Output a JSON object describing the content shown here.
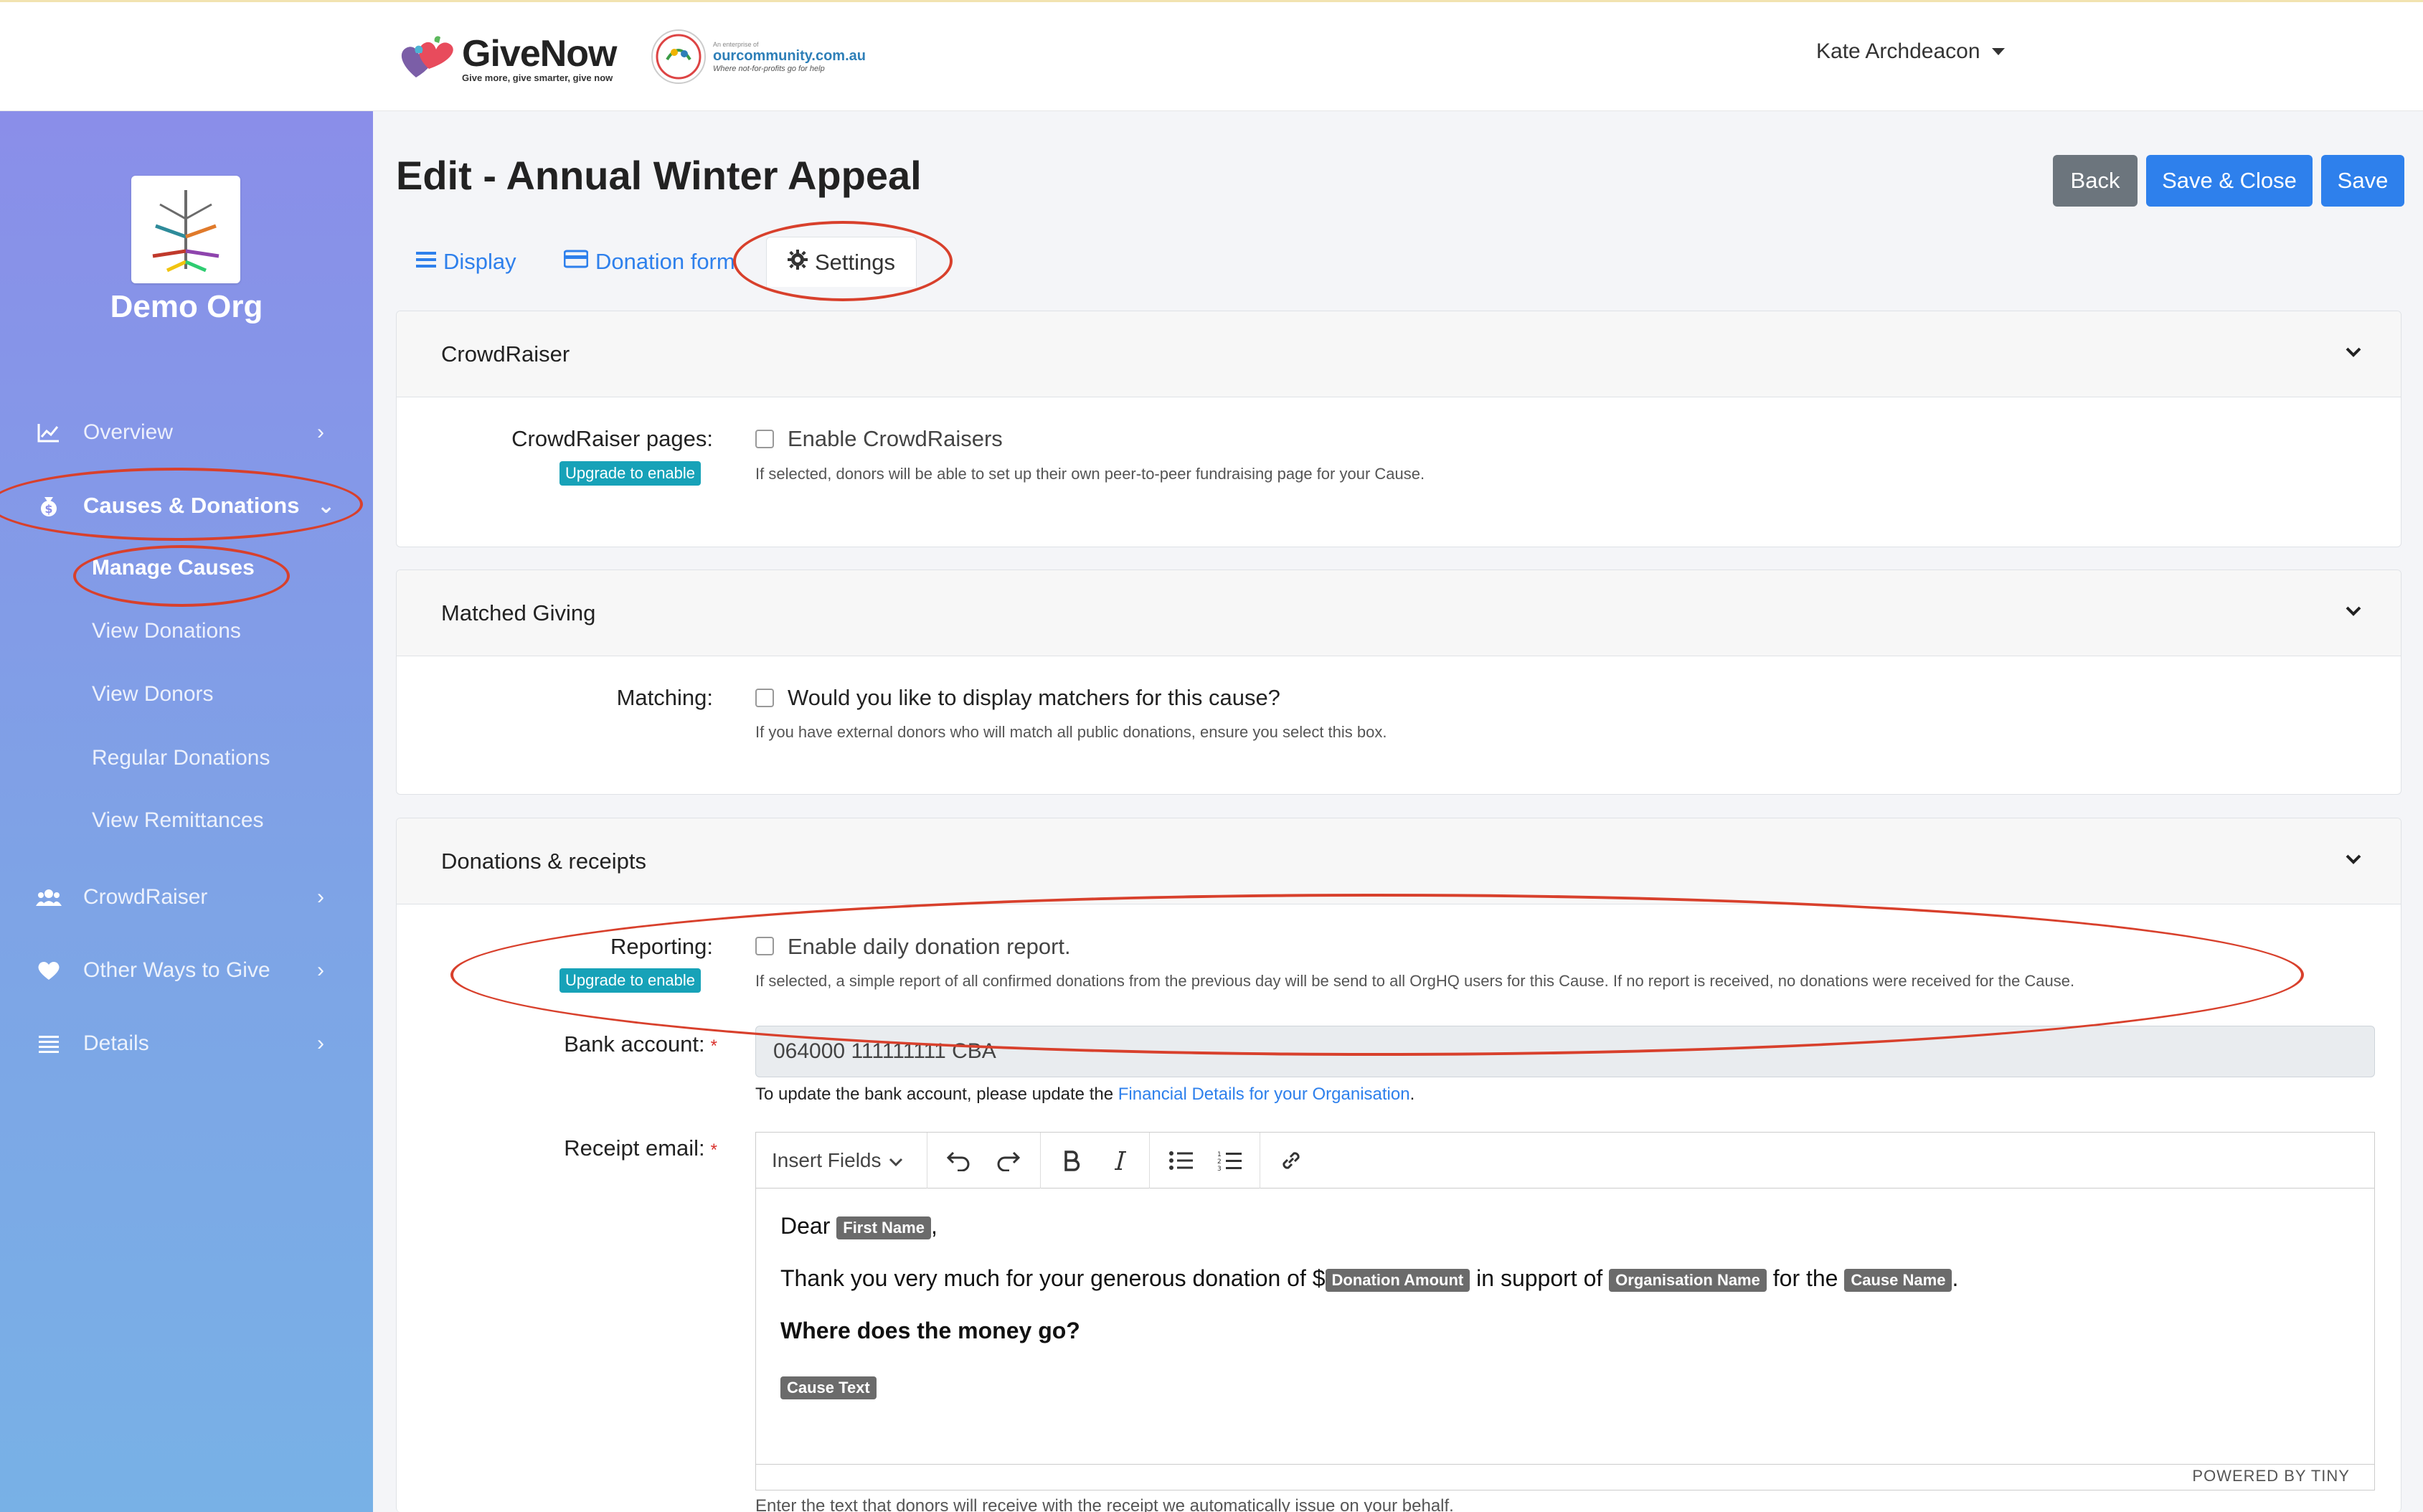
{
  "topbar": {
    "brand_name": "GiveNow",
    "brand_tagline": "Give more, give smarter, give now",
    "partner_small": "An enterprise of",
    "partner_name": "ourcommunity.com.au",
    "partner_tagline": "Where not-for-profits go for help",
    "user_name": "Kate Archdeacon"
  },
  "sidebar": {
    "org_name": "Demo Org",
    "items": [
      {
        "label": "Overview",
        "icon": "chart-line-icon"
      },
      {
        "label": "Causes & Donations",
        "icon": "money-bag-icon"
      },
      {
        "label": "CrowdRaiser",
        "icon": "users-icon"
      },
      {
        "label": "Other Ways to Give",
        "icon": "heart-icon"
      },
      {
        "label": "Details",
        "icon": "list-icon"
      }
    ],
    "subitems": [
      "Manage Causes",
      "View Donations",
      "View Donors",
      "Regular Donations",
      "View Remittances"
    ]
  },
  "page": {
    "title": "Edit - Annual Winter Appeal",
    "buttons": {
      "back": "Back",
      "save_close": "Save & Close",
      "save": "Save"
    },
    "tabs": {
      "display": "Display",
      "donation_form": "Donation form",
      "settings": "Settings"
    }
  },
  "crowdraiser": {
    "title": "CrowdRaiser",
    "label": "CrowdRaiser pages:",
    "badge": "Upgrade to enable",
    "checkbox": "Enable CrowdRaisers",
    "help": "If selected, donors will be able to set up their own peer-to-peer fundraising page for your Cause."
  },
  "matched": {
    "title": "Matched Giving",
    "label": "Matching:",
    "checkbox": "Would you like to display matchers for this cause?",
    "help": "If you have external donors who will match all public donations, ensure you select this box."
  },
  "donations": {
    "title": "Donations & receipts",
    "reporting_label": "Reporting:",
    "badge": "Upgrade to enable",
    "reporting_checkbox": "Enable daily donation report.",
    "reporting_help": "If selected, a simple report of all confirmed donations from the previous day will be send to all OrgHQ users for this Cause. If no report is received, no donations were received for the Cause.",
    "bank_label": "Bank account:",
    "bank_value": "064000 111111111 CBA",
    "bank_help_prefix": "To update the bank account, please update the ",
    "bank_help_link": "Financial Details for your Organisation",
    "bank_help_suffix": ".",
    "receipt_label": "Receipt email:",
    "required_mark": "*",
    "editor": {
      "insert_fields": "Insert Fields",
      "line1_prefix": "Dear ",
      "tag_first_name": "First Name",
      "line1_suffix": ",",
      "line2_prefix": "Thank you very much for your generous donation of $",
      "tag_amount": "Donation Amount",
      "line2_mid1": " in support of ",
      "tag_org": "Organisation Name",
      "line2_mid2": " for the ",
      "tag_cause": "Cause Name",
      "line2_suffix": ".",
      "heading": "Where does the money go?",
      "tag_cause_text": "Cause Text",
      "powered": "POWERED BY TINY"
    },
    "editor_help": "Enter the text that donors will receive with the receipt we automatically issue on your behalf."
  },
  "colors": {
    "primary": "#2e80ec",
    "secondary": "#6c757d",
    "badge": "#17a2b8",
    "annotation": "#d8402c"
  }
}
